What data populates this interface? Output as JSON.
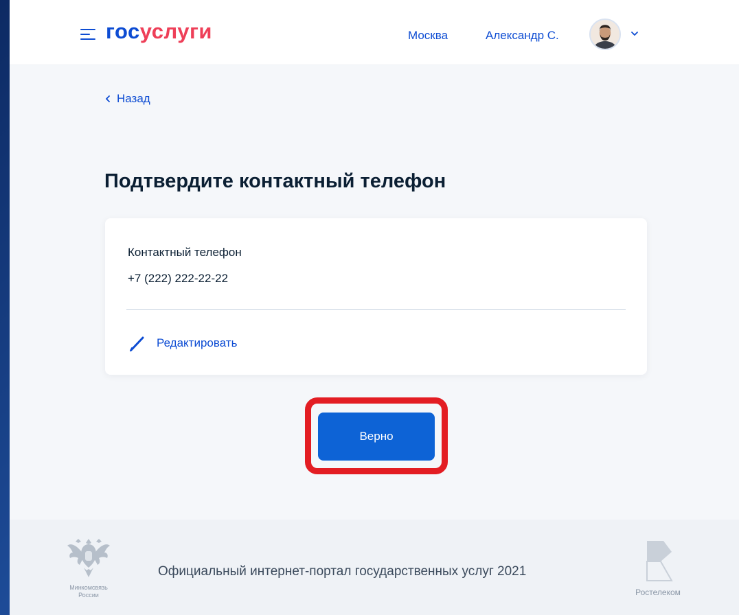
{
  "header": {
    "logo_part1": "гос",
    "logo_part2": "услуги",
    "city": "Москва",
    "user_name": "Александр С."
  },
  "nav": {
    "back_label": "Назад"
  },
  "page": {
    "title": "Подтвердите контактный телефон"
  },
  "contact_card": {
    "label": "Контактный телефон",
    "phone": "+7 (222) 222-22-22",
    "edit_label": "Редактировать"
  },
  "actions": {
    "confirm_label": "Верно"
  },
  "footer": {
    "text": "Официальный интернет-портал государственных услуг 2021",
    "ministry_line1": "Минкомсвязь",
    "ministry_line2": "России",
    "partner": "Ростелеком"
  },
  "colors": {
    "brand_blue": "#0d4cd3",
    "brand_red": "#ee3f58",
    "button_blue": "#0d63d6",
    "highlight_red": "#e31d23"
  },
  "icons": {
    "menu": "hamburger-icon",
    "back": "chevron-left-icon",
    "user_dropdown": "chevron-down-icon",
    "edit": "pencil-icon"
  }
}
